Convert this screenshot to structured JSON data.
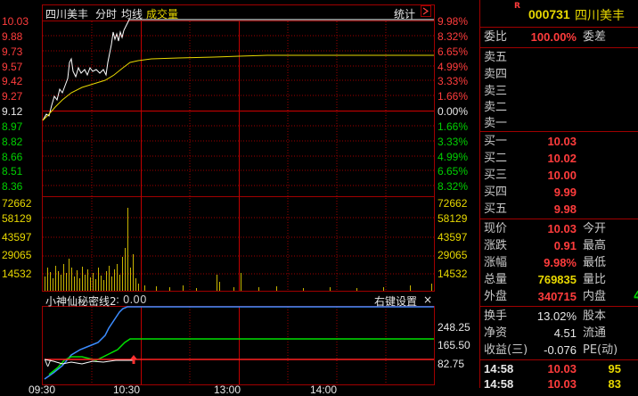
{
  "header": {
    "stock_name": "四川美丰",
    "tab_timeshare": "分时",
    "legend_avg": "均线",
    "legend_volume": "成交量",
    "stats_button": "统计"
  },
  "price_axis": {
    "left": [
      "10.03",
      "9.88",
      "9.73",
      "9.57",
      "9.42",
      "9.27",
      "9.12",
      "8.97",
      "8.82",
      "8.66",
      "8.51",
      "8.36"
    ],
    "right": [
      "9.98%",
      "8.32%",
      "6.65%",
      "4.99%",
      "3.33%",
      "1.66%",
      "0.00%",
      "1.66%",
      "3.33%",
      "4.99%",
      "6.65%",
      "8.32%"
    ]
  },
  "volume_axis": {
    "left": [
      "72662",
      "58129",
      "43597",
      "29065",
      "14532"
    ],
    "right": [
      "72662",
      "58129",
      "43597",
      "29065",
      "14532"
    ]
  },
  "indicator": {
    "title": "小神仙秘密线2",
    "param": ": 0.00",
    "right_settings": "右键设置",
    "close": "×",
    "axis": [
      "248.25",
      "165.50",
      "82.75"
    ]
  },
  "time_axis": [
    "09:30",
    "10:30",
    "13:00",
    "14:00"
  ],
  "panel": {
    "badge": "R",
    "code": "000731",
    "name": "四川美丰",
    "commission_ratio_label": "委比",
    "commission_ratio_value": "100.00%",
    "commission_diff_label": "委差",
    "asks": [
      {
        "label": "卖五",
        "price": ""
      },
      {
        "label": "卖四",
        "price": ""
      },
      {
        "label": "卖三",
        "price": ""
      },
      {
        "label": "卖二",
        "price": ""
      },
      {
        "label": "卖一",
        "price": ""
      }
    ],
    "bids": [
      {
        "label": "买一",
        "price": "10.03"
      },
      {
        "label": "买二",
        "price": "10.02"
      },
      {
        "label": "买三",
        "price": "10.00"
      },
      {
        "label": "买四",
        "price": "9.99"
      },
      {
        "label": "买五",
        "price": "9.98"
      }
    ],
    "quote": [
      {
        "l1": "现价",
        "v": "10.03",
        "l2": "今开",
        "color": "#ff3c3c"
      },
      {
        "l1": "涨跌",
        "v": "0.91",
        "l2": "最高",
        "color": "#ff3c3c"
      },
      {
        "l1": "涨幅",
        "v": "9.98%",
        "l2": "最低",
        "color": "#ff3c3c"
      },
      {
        "l1": "总量",
        "v": "769835",
        "l2": "量比",
        "color": "#e8d800"
      },
      {
        "l1": "外盘",
        "v": "340715",
        "l2": "内盘",
        "color": "#ff3c3c"
      }
    ],
    "extra": [
      {
        "l1": "换手",
        "v": "13.02%",
        "l2": "股本"
      },
      {
        "l1": "净资",
        "v": "4.51",
        "l2": "流通"
      },
      {
        "l1": "收益(三)",
        "v": "-0.076",
        "l2": "PE(动)"
      }
    ],
    "ticks": [
      {
        "time": "14:58",
        "price": "10.03",
        "vol": "95"
      },
      {
        "time": "14:58",
        "price": "10.03",
        "vol": "83"
      }
    ],
    "inner_disk_partial": "4"
  },
  "colors": {
    "up": "#ff3c3c",
    "down": "#00d000",
    "grid": "#a00000",
    "price_line": "#ffffff",
    "avg_line": "#e8d800",
    "volume": "#c8b400",
    "ind_blue": "#3c8cff",
    "ind_green": "#00e000",
    "ind_red": "#ff2020"
  }
}
